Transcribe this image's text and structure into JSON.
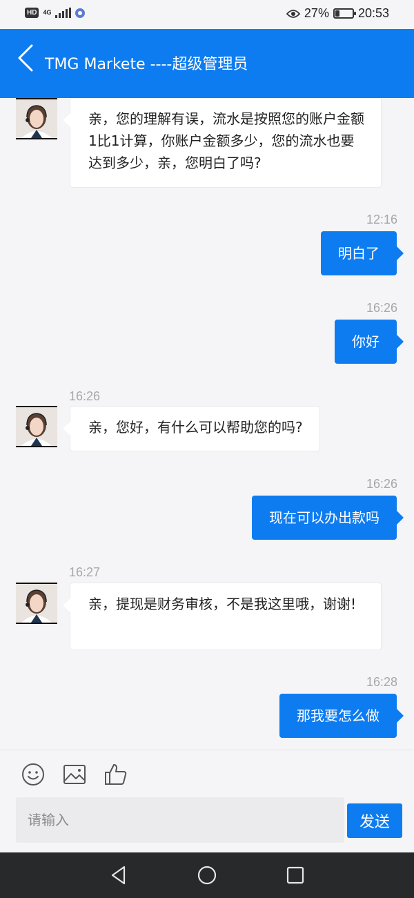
{
  "status_bar": {
    "network": "HD",
    "network_type": "4G",
    "battery_percent": "27%",
    "battery_level": 0.27,
    "time": "20:53"
  },
  "header": {
    "back_icon": "chevron-left-icon",
    "title": "TMG Markete ----超级管理员"
  },
  "colors": {
    "brand_blue": "#0e7cf1",
    "background": "#f5f5f7",
    "bubble_incoming": "#ffffff",
    "nav_bar": "#28292b"
  },
  "messages": [
    {
      "side": "in",
      "time": "",
      "text": "亲，您的理解有误，流水是按照您的账户金额1比1计算，你账户金额多少，您的流水也要达到多少，亲，您明白了吗?"
    },
    {
      "side": "out",
      "time": "12:16",
      "text": "明白了"
    },
    {
      "side": "out",
      "time": "16:26",
      "text": "你好"
    },
    {
      "side": "in",
      "time": "16:26",
      "text": "亲，您好，有什么可以帮助您的吗?"
    },
    {
      "side": "out",
      "time": "16:26",
      "text": "现在可以办出款吗"
    },
    {
      "side": "in",
      "time": "16:27",
      "text": "亲，提现是财务审核，不是我这里哦，谢谢!"
    },
    {
      "side": "out",
      "time": "16:28",
      "text": "那我要怎么做"
    }
  ],
  "toolbar": {
    "icons": [
      "emoji-icon",
      "image-icon",
      "thumbs-up-icon"
    ],
    "input_placeholder": "请输入",
    "input_value": "",
    "send_label": "发送"
  },
  "nav_bar": {
    "buttons": [
      "back-triangle-icon",
      "home-circle-icon",
      "recents-square-icon"
    ]
  }
}
